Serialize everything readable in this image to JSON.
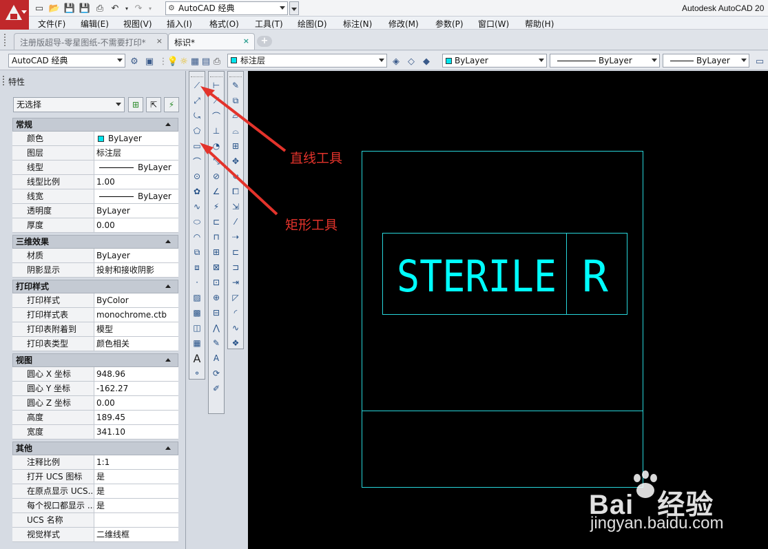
{
  "window": {
    "app_title": "Autodesk AutoCAD 20",
    "workspace": "AutoCAD 经典"
  },
  "menu": [
    "文件(F)",
    "编辑(E)",
    "视图(V)",
    "插入(I)",
    "格式(O)",
    "工具(T)",
    "绘图(D)",
    "标注(N)",
    "修改(M)",
    "参数(P)",
    "窗口(W)",
    "帮助(H)"
  ],
  "tabs": [
    {
      "label": "注册版超导-零星图纸-不需要打印*",
      "close": "×"
    },
    {
      "label": "标识*",
      "close": "×"
    }
  ],
  "toolbar": {
    "workspace": "AutoCAD 经典",
    "layer": "标注层",
    "color": "ByLayer",
    "linetype": "ByLayer",
    "lineweight": "ByLayer"
  },
  "properties": {
    "title": "特性",
    "selection": "无选择",
    "sections": [
      {
        "title": "常规",
        "rows": [
          {
            "key": "颜色",
            "value": "ByLayer",
            "kind": "color"
          },
          {
            "key": "图层",
            "value": "标注层"
          },
          {
            "key": "线型",
            "value": "ByLayer",
            "kind": "line"
          },
          {
            "key": "线型比例",
            "value": "1.00"
          },
          {
            "key": "线宽",
            "value": "ByLayer",
            "kind": "line"
          },
          {
            "key": "透明度",
            "value": "ByLayer"
          },
          {
            "key": "厚度",
            "value": "0.00"
          }
        ]
      },
      {
        "title": "三维效果",
        "rows": [
          {
            "key": "材质",
            "value": "ByLayer"
          },
          {
            "key": "阴影显示",
            "value": "投射和接收阴影"
          }
        ]
      },
      {
        "title": "打印样式",
        "rows": [
          {
            "key": "打印样式",
            "value": "ByColor"
          },
          {
            "key": "打印样式表",
            "value": "monochrome.ctb"
          },
          {
            "key": "打印表附着到",
            "value": "模型"
          },
          {
            "key": "打印表类型",
            "value": "颜色相关"
          }
        ]
      },
      {
        "title": "视图",
        "rows": [
          {
            "key": "圆心 X 坐标",
            "value": "948.96"
          },
          {
            "key": "圆心 Y 坐标",
            "value": "-162.27"
          },
          {
            "key": "圆心 Z 坐标",
            "value": "0.00"
          },
          {
            "key": "高度",
            "value": "189.45"
          },
          {
            "key": "宽度",
            "value": "341.10"
          }
        ]
      },
      {
        "title": "其他",
        "rows": [
          {
            "key": "注释比例",
            "value": "1:1"
          },
          {
            "key": "打开 UCS 图标",
            "value": "是"
          },
          {
            "key": "在原点显示 UCS...",
            "value": "是"
          },
          {
            "key": "每个视口都显示 ...",
            "value": "是"
          },
          {
            "key": "UCS 名称",
            "value": ""
          },
          {
            "key": "视觉样式",
            "value": "二维线框"
          }
        ]
      }
    ]
  },
  "drawing": {
    "text_sterile": "STERILE",
    "text_r": "R",
    "line_color": "#28d7dc",
    "text_color": "#00ffff"
  },
  "annotations": {
    "line_tool": "直线工具",
    "rect_tool": "矩形工具",
    "color": "#e3332b"
  },
  "watermark": {
    "logo_left": "Bai",
    "logo_right": "经验",
    "url": "jingyan.baidu.com"
  }
}
